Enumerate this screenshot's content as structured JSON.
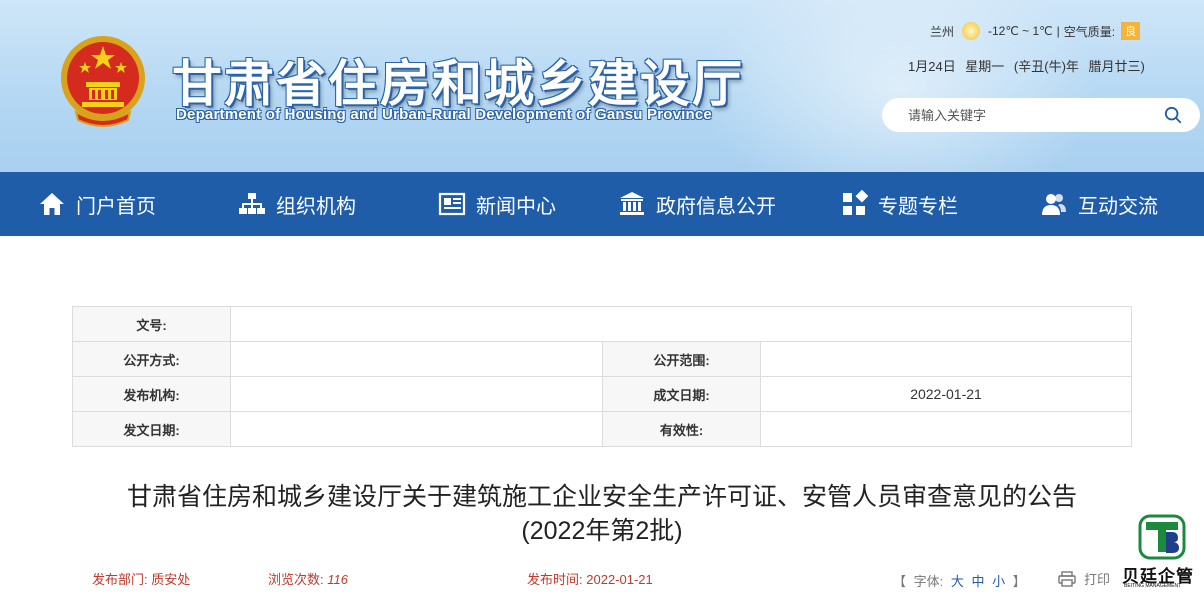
{
  "header": {
    "title": "甘肃省住房和城乡建设厅",
    "subtitle": "Department of Housing and Urban-Rural Development of Gansu Province",
    "weather": {
      "city": "兰州",
      "temp": "-12℃ ~ 1℃",
      "separator": "|",
      "aq_label": "空气质量:",
      "aq_value": "良"
    },
    "date": "1月24日 星期一 (辛丑(牛)年 腊月廿三)",
    "search": {
      "placeholder": "请输入关键字"
    },
    "colors": {
      "nav": "#1f5da8",
      "aq": "#f2b43a"
    }
  },
  "nav": {
    "items": [
      {
        "label": "门户首页",
        "icon": "home-icon"
      },
      {
        "label": "组织机构",
        "icon": "org-chart-icon"
      },
      {
        "label": "新闻中心",
        "icon": "news-icon"
      },
      {
        "label": "政府信息公开",
        "icon": "government-building-icon"
      },
      {
        "label": "专题专栏",
        "icon": "grid-icon"
      },
      {
        "label": "互动交流",
        "icon": "users-icon"
      }
    ]
  },
  "meta": {
    "doc_no_label": "文号:",
    "disclosure_method_label": "公开方式:",
    "disclosure_scope_label": "公开范围:",
    "issuer_label": "发布机构:",
    "written_date_label": "成文日期:",
    "written_date_value": "2022-01-21",
    "issue_date_label": "发文日期:",
    "validity_label": "有效性:"
  },
  "article": {
    "title_line1": "甘肃省住房和城乡建设厅关于建筑施工企业安全生产许可证、安管人员审查意见的公告",
    "title_line2": "(2022年第2批)",
    "dept_label": "发布部门:",
    "dept_value": "质安处",
    "views_label": "浏览次数:",
    "views_value": "116",
    "time_label": "发布时间:",
    "time_value": "2022-01-21",
    "font_label": "【 字体:",
    "font_large": "大",
    "font_medium": "中",
    "font_small": "小",
    "font_close": "】",
    "print_label": "打印"
  },
  "watermark": {
    "name": "贝廷企管",
    "en": "BEITING MANAGEMENT"
  }
}
